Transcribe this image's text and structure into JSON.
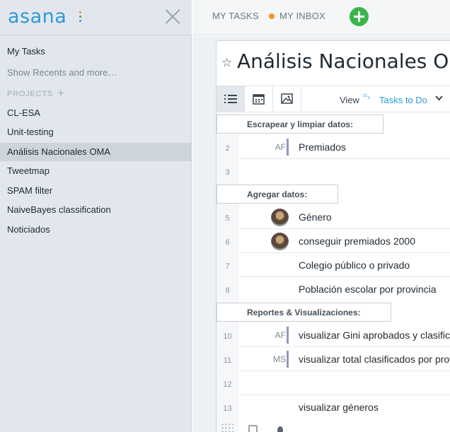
{
  "sidebar": {
    "logo": "asana",
    "logo_dot_colors": [
      "#f39523",
      "#3bb54a",
      "#2d9ad7"
    ],
    "my_tasks": "My Tasks",
    "show_recents": "Show Recents and more…",
    "projects_heading": "PROJECTS",
    "projects": [
      {
        "label": "CL-ESA",
        "active": false
      },
      {
        "label": "Unit-testing",
        "active": false
      },
      {
        "label": "Análisis Nacionales OMA",
        "active": true
      },
      {
        "label": "Tweetmap",
        "active": false
      },
      {
        "label": "SPAM filter",
        "active": false
      },
      {
        "label": "NaiveBayes classification",
        "active": false
      },
      {
        "label": "Noticiados",
        "active": false
      }
    ]
  },
  "topbar": {
    "my_tasks": "MY TASKS",
    "my_inbox": "MY INBOX",
    "inbox_dot_color": "#f39523",
    "add_button_color": "#3bb54a"
  },
  "project": {
    "title": "Análisis Nacionales OMA",
    "view_label": "View",
    "view_icon": "sort-123-icon",
    "view_value": "Tasks to Do"
  },
  "rows": {
    "section_1": "Escrapear y limpiar datos:",
    "n2": "2",
    "a2": "AF",
    "t2": "Premiados",
    "n3": "3",
    "section_2": "Agregar datos:",
    "n5": "5",
    "t5": "Género",
    "n6": "6",
    "t6": "conseguir premiados 2000",
    "n7": "7",
    "t7": "Colegio público o privado",
    "n8": "8",
    "t8": "Población escolar por provincia",
    "section_3": "Reportes & Visualizaciones:",
    "n10": "10",
    "a10": "AF",
    "t10": "visualizar Gini aprobados y clasificados",
    "n11": "11",
    "a11": "MS",
    "t11": "visualizar total clasificados por provincia",
    "n12": "12",
    "n13": "13",
    "t13": "visualizar géneros"
  }
}
